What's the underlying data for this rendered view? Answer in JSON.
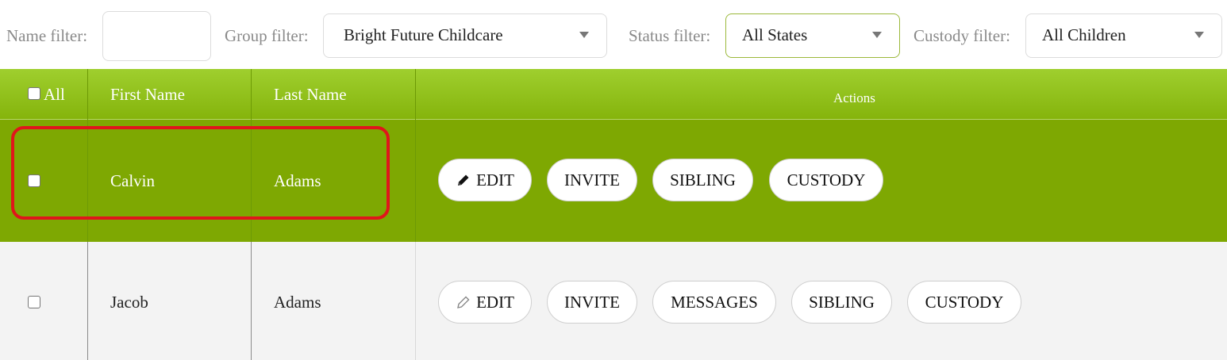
{
  "filters": {
    "name_label": "Name filter:",
    "name_value": "",
    "group_label": "Group filter:",
    "group_value": "Bright Future Childcare",
    "status_label": "Status filter:",
    "status_value": "All States",
    "custody_label": "Custody filter:",
    "custody_value": "All Children"
  },
  "table": {
    "headers": {
      "all": "All",
      "first_name": "First Name",
      "last_name": "Last Name",
      "actions": "Actions"
    },
    "rows": [
      {
        "first_name": "Calvin",
        "last_name": "Adams",
        "actions": [
          "EDIT",
          "INVITE",
          "SIBLING",
          "CUSTODY"
        ],
        "selected": true
      },
      {
        "first_name": "Jacob",
        "last_name": "Adams",
        "actions": [
          "EDIT",
          "INVITE",
          "MESSAGES",
          "SIBLING",
          "CUSTODY"
        ],
        "selected": false
      }
    ]
  },
  "colors": {
    "header_green": "#8fc01d",
    "selected_row": "#7ea802",
    "highlight": "#e0161b"
  },
  "icons": [
    "pencil-icon",
    "chevron-down-icon"
  ]
}
